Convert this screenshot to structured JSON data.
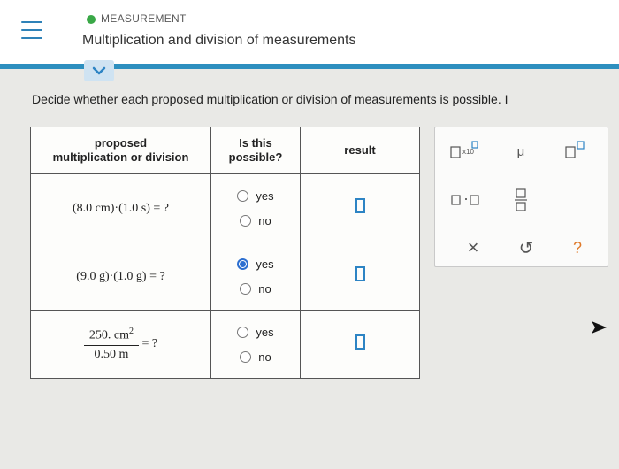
{
  "header": {
    "topic": "MEASUREMENT",
    "title": "Multiplication and division of measurements"
  },
  "prompt": "Decide whether each proposed multiplication or division of measurements is possible. I",
  "table": {
    "headers": {
      "proposed": [
        "proposed",
        "multiplication or division"
      ],
      "possible": [
        "Is this",
        "possible?"
      ],
      "result": "result"
    },
    "rows": [
      {
        "expression": "(8.0 cm)·(1.0 s) = ?",
        "options": [
          "yes",
          "no"
        ],
        "selected": null
      },
      {
        "expression": "(9.0 g)·(1.0 g) = ?",
        "options": [
          "yes",
          "no"
        ],
        "selected": "yes"
      },
      {
        "numerator": "250. cm",
        "exponent": "2",
        "denominator": "0.50 m",
        "equals": "= ?",
        "options": [
          "yes",
          "no"
        ],
        "selected": null
      }
    ]
  },
  "palette": {
    "x10_label": "x10",
    "mu_label": "μ",
    "dot_label": "·",
    "clear_label": "×",
    "undo_label": "↺",
    "help_label": "?",
    "colors": {
      "icon_blue": "#2d84c4",
      "icon_gray": "#555555",
      "help_orange": "#e07a2a"
    }
  }
}
